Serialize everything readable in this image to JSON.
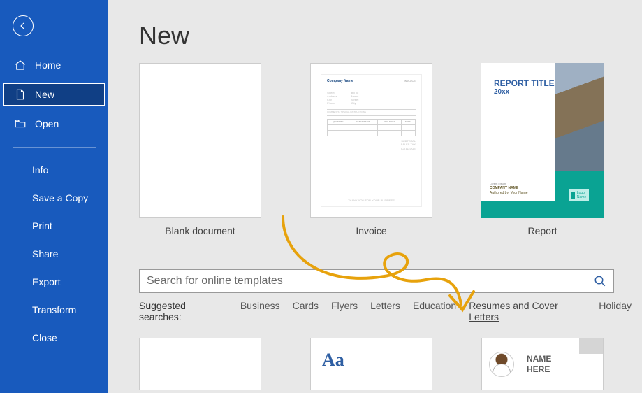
{
  "sidebar": {
    "items": [
      {
        "label": "Home"
      },
      {
        "label": "New"
      },
      {
        "label": "Open"
      }
    ],
    "secondary": [
      "Info",
      "Save a Copy",
      "Print",
      "Share",
      "Export",
      "Transform",
      "Close"
    ]
  },
  "page": {
    "title": "New"
  },
  "templates": {
    "row1": [
      {
        "label": "Blank document"
      },
      {
        "label": "Invoice"
      },
      {
        "label": "Report"
      }
    ],
    "invoice": {
      "company": "Company Name",
      "tag": "INVOICE"
    },
    "report": {
      "title1": "REPORT TITLE",
      "title2": "20xx",
      "company": "COMPANY NAME",
      "author": "Authored by: Your Name",
      "logo": "Logo Name"
    },
    "row2": {
      "aa": "Aa",
      "name1": "NAME",
      "name2": "HERE"
    }
  },
  "search": {
    "placeholder": "Search for online templates"
  },
  "suggested": {
    "label": "Suggested searches:",
    "items": [
      "Business",
      "Cards",
      "Flyers",
      "Letters",
      "Education",
      "Resumes and Cover Letters",
      "Holiday"
    ]
  }
}
